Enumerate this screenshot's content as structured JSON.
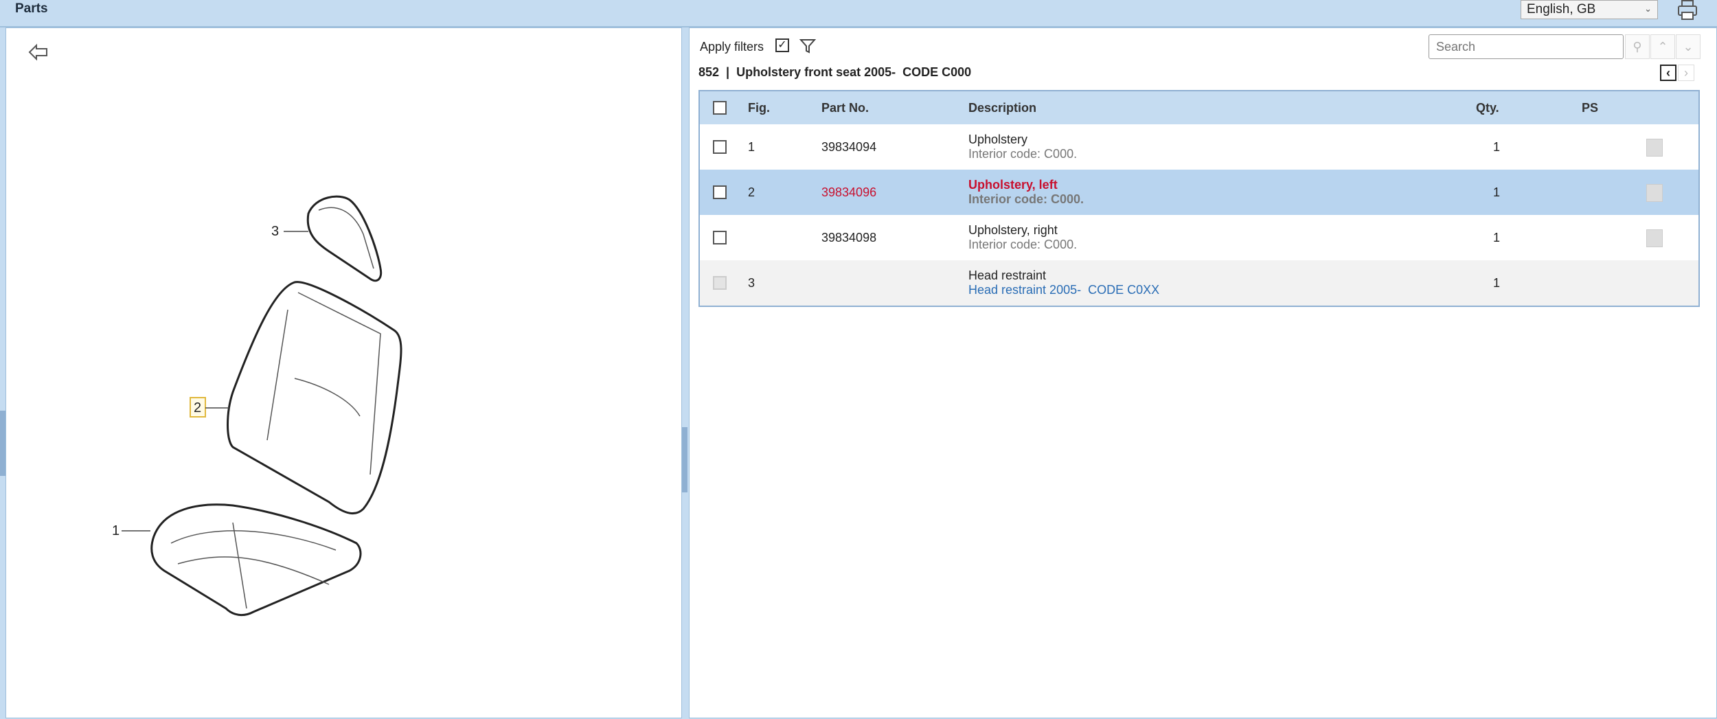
{
  "header": {
    "title": "Parts",
    "language": "English, GB"
  },
  "toolbar": {
    "apply_filters": "Apply filters",
    "apply_filters_checked": true,
    "search_placeholder": "Search"
  },
  "group": {
    "title": "852  |  Upholstery front seat 2005-  CODE C000"
  },
  "diagram": {
    "labels": [
      "1",
      "2",
      "3"
    ],
    "highlighted": "2"
  },
  "table": {
    "headers": {
      "fig": "Fig.",
      "part_no": "Part No.",
      "description": "Description",
      "qty": "Qty.",
      "ps": "PS"
    },
    "rows": [
      {
        "fig": "1",
        "part_no": "39834094",
        "description": "Upholstery",
        "sub": "Interior code: C000.",
        "qty": "1"
      },
      {
        "fig": "2",
        "part_no": "39834096",
        "description": "Upholstery, left",
        "sub": "Interior code: C000.",
        "qty": "1"
      },
      {
        "fig": "",
        "part_no": "39834098",
        "description": "Upholstery, right",
        "sub": "Interior code: C000.",
        "qty": "1"
      },
      {
        "fig": "3",
        "part_no": "",
        "description": "Head restraint",
        "sub": "Head restraint 2005-  CODE C0XX",
        "qty": "1"
      }
    ]
  },
  "colors": {
    "header_bg": "#c5dcf1",
    "selected_row": "#b8d4ef",
    "highlight_text": "#c8102e",
    "link": "#2a6db5"
  }
}
